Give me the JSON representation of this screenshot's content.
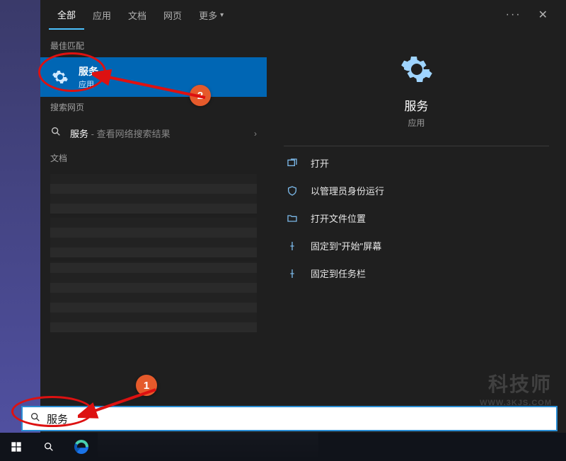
{
  "tabs": {
    "all": "全部",
    "apps": "应用",
    "docs": "文档",
    "web": "网页",
    "more": "更多"
  },
  "sections": {
    "best_match": "最佳匹配",
    "search_web": "搜索网页",
    "documents": "文档"
  },
  "best_match": {
    "title": "服务",
    "subtitle": "应用"
  },
  "web_search": {
    "term": "服务",
    "suffix": " - 查看网络搜索结果"
  },
  "preview": {
    "title": "服务",
    "subtitle": "应用"
  },
  "actions": {
    "open": "打开",
    "run_admin": "以管理员身份运行",
    "open_location": "打开文件位置",
    "pin_start": "固定到\"开始\"屏幕",
    "pin_taskbar": "固定到任务栏"
  },
  "search": {
    "value": "服务"
  },
  "watermark": {
    "line1": "科技师",
    "line2": "WWW.3KJS.COM"
  },
  "annotations": {
    "badge1": "1",
    "badge2": "2"
  }
}
